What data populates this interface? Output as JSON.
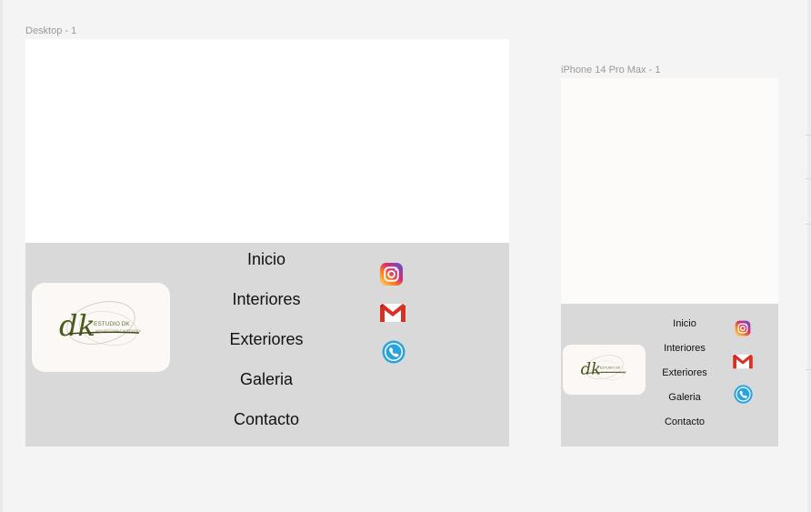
{
  "canvas": {
    "desktop_frame_label": "Desktop - 1",
    "phone_frame_label": "iPhone 14 Pro Max - 1"
  },
  "footer": {
    "logo": {
      "monogram": "dk",
      "name": "ESTUDIO DK",
      "tagline": "ARQUITECTURA E INTERIORES"
    },
    "nav_items": [
      "Inicio",
      "Interiores",
      "Exteriores",
      "Galeria",
      "Contacto"
    ],
    "social_icons": [
      "instagram-icon",
      "gmail-icon",
      "phone-icon"
    ]
  },
  "colors": {
    "canvas_bg": "#f4f4f4",
    "frame_bg": "#ffffff",
    "footer_bg": "#d9d9d9",
    "logo_card_bg": "#fbf8f5",
    "logo_green": "#4a5a1c",
    "gmail_red": "#d93025",
    "phone_blue": "#27a3e0"
  }
}
